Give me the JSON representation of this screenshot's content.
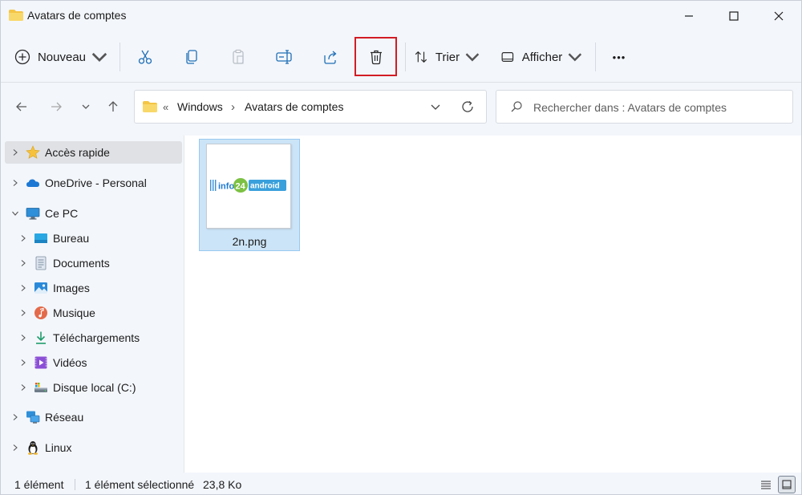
{
  "window": {
    "title": "Avatars de comptes"
  },
  "toolbar": {
    "new_label": "Nouveau",
    "sort_label": "Trier",
    "view_label": "Afficher",
    "more_label": "•••"
  },
  "address": {
    "overflow": "«",
    "crumbs": [
      "Windows",
      "Avatars de comptes"
    ],
    "separator": "›"
  },
  "search": {
    "placeholder": "Rechercher dans : Avatars de comptes"
  },
  "sidebar": {
    "items": [
      {
        "label": "Accès rapide",
        "icon": "star-icon"
      },
      {
        "label": "OneDrive - Personal",
        "icon": "cloud-icon"
      },
      {
        "label": "Ce PC",
        "icon": "monitor-icon"
      },
      {
        "label": "Bureau",
        "icon": "desktop-icon"
      },
      {
        "label": "Documents",
        "icon": "document-icon"
      },
      {
        "label": "Images",
        "icon": "image-icon"
      },
      {
        "label": "Musique",
        "icon": "music-icon"
      },
      {
        "label": "Téléchargements",
        "icon": "download-icon"
      },
      {
        "label": "Vidéos",
        "icon": "video-icon"
      },
      {
        "label": "Disque local (C:)",
        "icon": "drive-icon"
      },
      {
        "label": "Réseau",
        "icon": "network-icon"
      },
      {
        "label": "Linux",
        "icon": "linux-icon"
      }
    ]
  },
  "files": [
    {
      "name": "2n.png",
      "thumbnail_text_a": "info",
      "thumbnail_text_b": "24",
      "thumbnail_text_c": "android"
    }
  ],
  "status": {
    "count": "1 élément",
    "selected": "1 élément sélectionné",
    "size": "23,8 Ko"
  },
  "colors": {
    "highlight": "#d21c24",
    "selection": "#cce4f7",
    "folder": "#f4c545"
  }
}
